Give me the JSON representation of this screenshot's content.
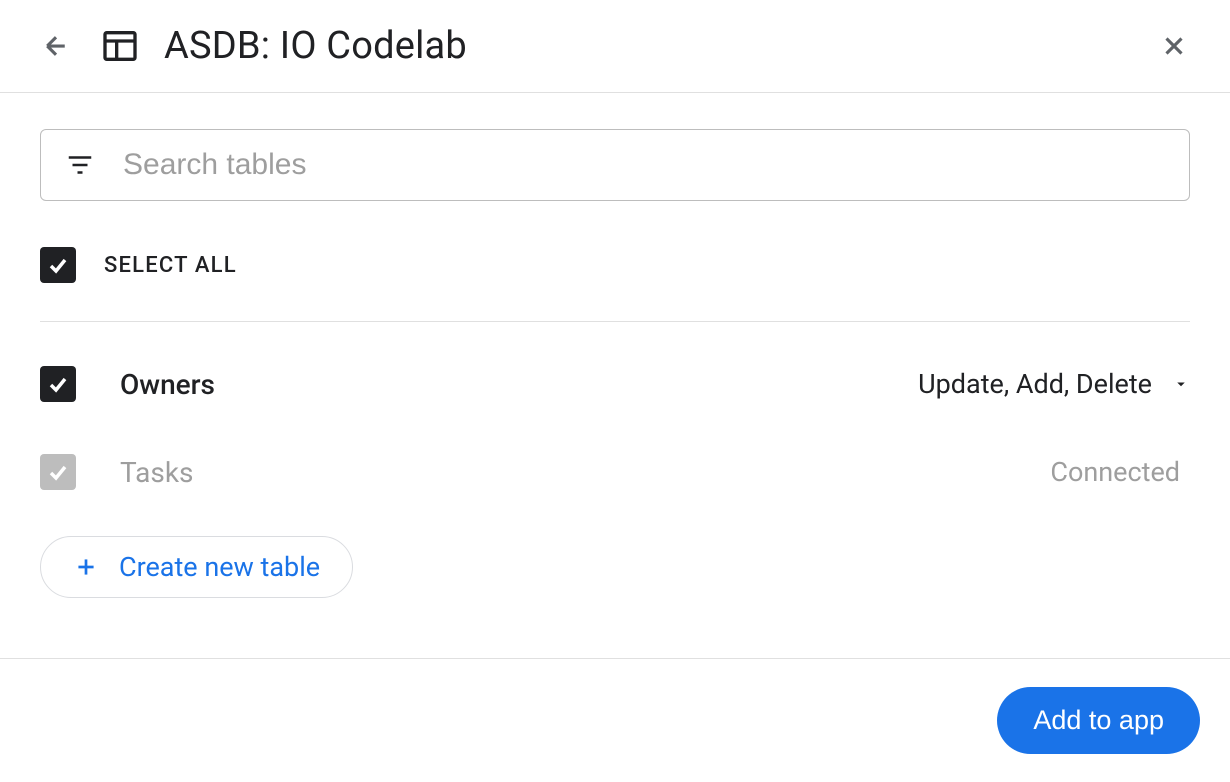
{
  "header": {
    "title": "ASDB: IO Codelab"
  },
  "search": {
    "placeholder": "Search tables"
  },
  "selectAll": {
    "label": "SELECT ALL"
  },
  "tables": [
    {
      "name": "Owners",
      "permissions": "Update, Add, Delete",
      "checked": true,
      "muted": false
    },
    {
      "name": "Tasks",
      "status": "Connected",
      "checked": true,
      "muted": true
    }
  ],
  "createTable": {
    "label": "Create new table"
  },
  "footer": {
    "addToApp": "Add to app"
  }
}
